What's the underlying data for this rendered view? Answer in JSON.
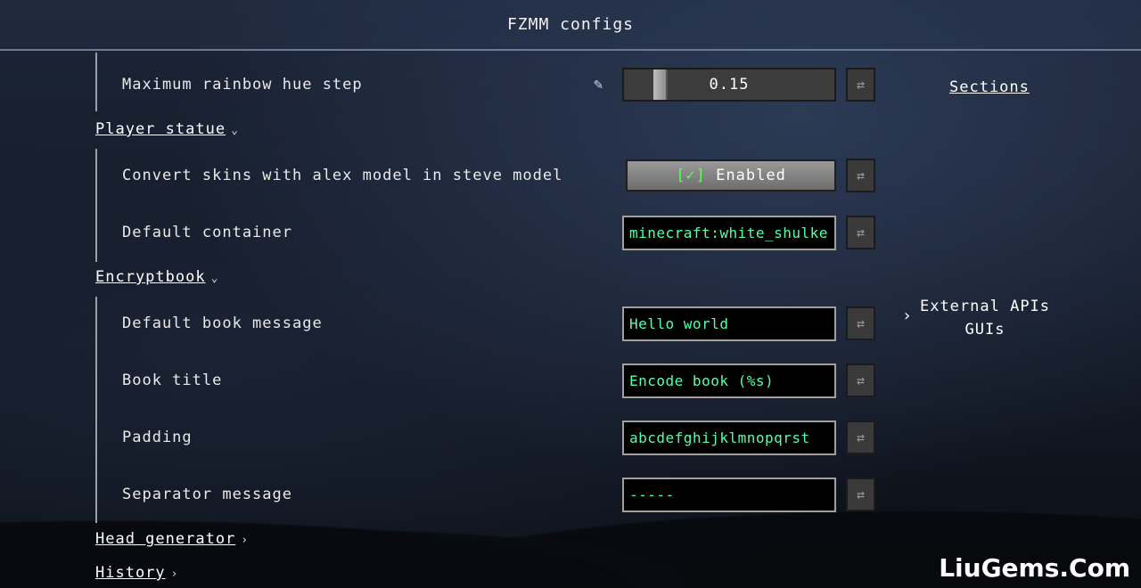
{
  "header": {
    "title": "FZMM configs"
  },
  "side": {
    "sections_link": "Sections",
    "external_label_1": "External APIs",
    "external_label_2": "GUIs",
    "chevron": "›"
  },
  "rows": {
    "rainbow": {
      "label": "Maximum rainbow hue step",
      "value": "0.15",
      "value_fraction": 0.15,
      "pencil": "✎"
    },
    "player_statue": {
      "title": "Player statue",
      "chevron": "⌄"
    },
    "alex": {
      "label": "Convert skins with alex model in steve model",
      "check": "[✓]",
      "state": "Enabled"
    },
    "container": {
      "label": "Default container",
      "value": "minecraft:white_shulke"
    },
    "encryptbook": {
      "title": "Encryptbook",
      "chevron": "⌄"
    },
    "book_message": {
      "label": "Default book message",
      "value": "Hello world"
    },
    "book_title": {
      "label": "Book title",
      "value": "Encode book (%s)"
    },
    "padding": {
      "label": "Padding",
      "value": "abcdefghijklmnopqrst"
    },
    "separator": {
      "label": "Separator message",
      "value": "-----"
    },
    "head_generator": {
      "title": "Head generator",
      "chevron": "›"
    },
    "history": {
      "title": "History",
      "chevron": "›"
    }
  },
  "reset_icon": "⇄",
  "watermark": "LiuGems.Com"
}
